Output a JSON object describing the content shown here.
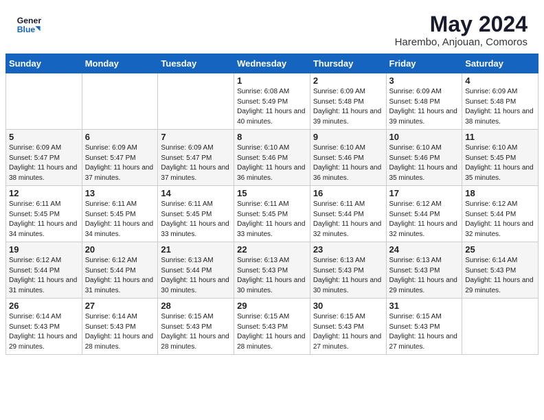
{
  "header": {
    "logo_line1": "General",
    "logo_line2": "Blue",
    "month_year": "May 2024",
    "location": "Harembo, Anjouan, Comoros"
  },
  "days_of_week": [
    "Sunday",
    "Monday",
    "Tuesday",
    "Wednesday",
    "Thursday",
    "Friday",
    "Saturday"
  ],
  "weeks": [
    [
      {
        "day": "",
        "sunrise": "",
        "sunset": "",
        "daylight": ""
      },
      {
        "day": "",
        "sunrise": "",
        "sunset": "",
        "daylight": ""
      },
      {
        "day": "",
        "sunrise": "",
        "sunset": "",
        "daylight": ""
      },
      {
        "day": "1",
        "sunrise": "Sunrise: 6:08 AM",
        "sunset": "Sunset: 5:49 PM",
        "daylight": "Daylight: 11 hours and 40 minutes."
      },
      {
        "day": "2",
        "sunrise": "Sunrise: 6:09 AM",
        "sunset": "Sunset: 5:48 PM",
        "daylight": "Daylight: 11 hours and 39 minutes."
      },
      {
        "day": "3",
        "sunrise": "Sunrise: 6:09 AM",
        "sunset": "Sunset: 5:48 PM",
        "daylight": "Daylight: 11 hours and 39 minutes."
      },
      {
        "day": "4",
        "sunrise": "Sunrise: 6:09 AM",
        "sunset": "Sunset: 5:48 PM",
        "daylight": "Daylight: 11 hours and 38 minutes."
      }
    ],
    [
      {
        "day": "5",
        "sunrise": "Sunrise: 6:09 AM",
        "sunset": "Sunset: 5:47 PM",
        "daylight": "Daylight: 11 hours and 38 minutes."
      },
      {
        "day": "6",
        "sunrise": "Sunrise: 6:09 AM",
        "sunset": "Sunset: 5:47 PM",
        "daylight": "Daylight: 11 hours and 37 minutes."
      },
      {
        "day": "7",
        "sunrise": "Sunrise: 6:09 AM",
        "sunset": "Sunset: 5:47 PM",
        "daylight": "Daylight: 11 hours and 37 minutes."
      },
      {
        "day": "8",
        "sunrise": "Sunrise: 6:10 AM",
        "sunset": "Sunset: 5:46 PM",
        "daylight": "Daylight: 11 hours and 36 minutes."
      },
      {
        "day": "9",
        "sunrise": "Sunrise: 6:10 AM",
        "sunset": "Sunset: 5:46 PM",
        "daylight": "Daylight: 11 hours and 36 minutes."
      },
      {
        "day": "10",
        "sunrise": "Sunrise: 6:10 AM",
        "sunset": "Sunset: 5:46 PM",
        "daylight": "Daylight: 11 hours and 35 minutes."
      },
      {
        "day": "11",
        "sunrise": "Sunrise: 6:10 AM",
        "sunset": "Sunset: 5:45 PM",
        "daylight": "Daylight: 11 hours and 35 minutes."
      }
    ],
    [
      {
        "day": "12",
        "sunrise": "Sunrise: 6:11 AM",
        "sunset": "Sunset: 5:45 PM",
        "daylight": "Daylight: 11 hours and 34 minutes."
      },
      {
        "day": "13",
        "sunrise": "Sunrise: 6:11 AM",
        "sunset": "Sunset: 5:45 PM",
        "daylight": "Daylight: 11 hours and 34 minutes."
      },
      {
        "day": "14",
        "sunrise": "Sunrise: 6:11 AM",
        "sunset": "Sunset: 5:45 PM",
        "daylight": "Daylight: 11 hours and 33 minutes."
      },
      {
        "day": "15",
        "sunrise": "Sunrise: 6:11 AM",
        "sunset": "Sunset: 5:45 PM",
        "daylight": "Daylight: 11 hours and 33 minutes."
      },
      {
        "day": "16",
        "sunrise": "Sunrise: 6:11 AM",
        "sunset": "Sunset: 5:44 PM",
        "daylight": "Daylight: 11 hours and 32 minutes."
      },
      {
        "day": "17",
        "sunrise": "Sunrise: 6:12 AM",
        "sunset": "Sunset: 5:44 PM",
        "daylight": "Daylight: 11 hours and 32 minutes."
      },
      {
        "day": "18",
        "sunrise": "Sunrise: 6:12 AM",
        "sunset": "Sunset: 5:44 PM",
        "daylight": "Daylight: 11 hours and 32 minutes."
      }
    ],
    [
      {
        "day": "19",
        "sunrise": "Sunrise: 6:12 AM",
        "sunset": "Sunset: 5:44 PM",
        "daylight": "Daylight: 11 hours and 31 minutes."
      },
      {
        "day": "20",
        "sunrise": "Sunrise: 6:12 AM",
        "sunset": "Sunset: 5:44 PM",
        "daylight": "Daylight: 11 hours and 31 minutes."
      },
      {
        "day": "21",
        "sunrise": "Sunrise: 6:13 AM",
        "sunset": "Sunset: 5:44 PM",
        "daylight": "Daylight: 11 hours and 30 minutes."
      },
      {
        "day": "22",
        "sunrise": "Sunrise: 6:13 AM",
        "sunset": "Sunset: 5:43 PM",
        "daylight": "Daylight: 11 hours and 30 minutes."
      },
      {
        "day": "23",
        "sunrise": "Sunrise: 6:13 AM",
        "sunset": "Sunset: 5:43 PM",
        "daylight": "Daylight: 11 hours and 30 minutes."
      },
      {
        "day": "24",
        "sunrise": "Sunrise: 6:13 AM",
        "sunset": "Sunset: 5:43 PM",
        "daylight": "Daylight: 11 hours and 29 minutes."
      },
      {
        "day": "25",
        "sunrise": "Sunrise: 6:14 AM",
        "sunset": "Sunset: 5:43 PM",
        "daylight": "Daylight: 11 hours and 29 minutes."
      }
    ],
    [
      {
        "day": "26",
        "sunrise": "Sunrise: 6:14 AM",
        "sunset": "Sunset: 5:43 PM",
        "daylight": "Daylight: 11 hours and 29 minutes."
      },
      {
        "day": "27",
        "sunrise": "Sunrise: 6:14 AM",
        "sunset": "Sunset: 5:43 PM",
        "daylight": "Daylight: 11 hours and 28 minutes."
      },
      {
        "day": "28",
        "sunrise": "Sunrise: 6:15 AM",
        "sunset": "Sunset: 5:43 PM",
        "daylight": "Daylight: 11 hours and 28 minutes."
      },
      {
        "day": "29",
        "sunrise": "Sunrise: 6:15 AM",
        "sunset": "Sunset: 5:43 PM",
        "daylight": "Daylight: 11 hours and 28 minutes."
      },
      {
        "day": "30",
        "sunrise": "Sunrise: 6:15 AM",
        "sunset": "Sunset: 5:43 PM",
        "daylight": "Daylight: 11 hours and 27 minutes."
      },
      {
        "day": "31",
        "sunrise": "Sunrise: 6:15 AM",
        "sunset": "Sunset: 5:43 PM",
        "daylight": "Daylight: 11 hours and 27 minutes."
      },
      {
        "day": "",
        "sunrise": "",
        "sunset": "",
        "daylight": ""
      }
    ]
  ]
}
